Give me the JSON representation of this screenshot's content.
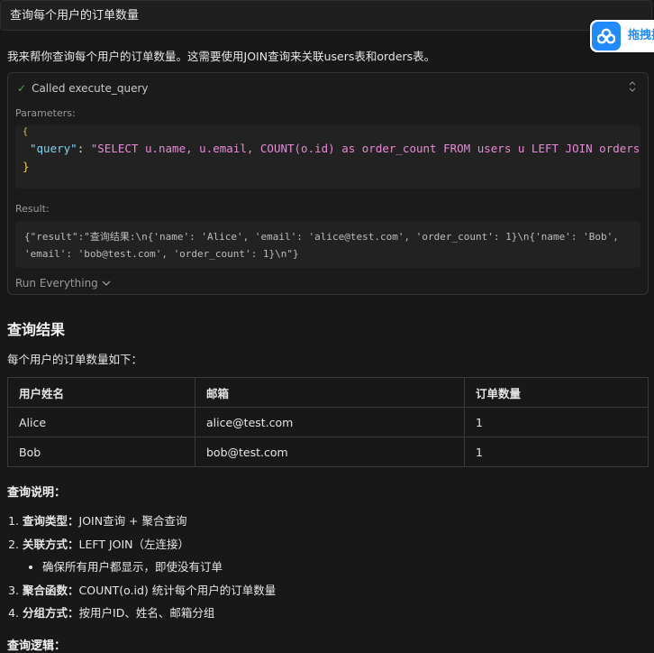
{
  "user_message": "查询每个用户的订单数量",
  "floating_button": {
    "label": "拖拽搜",
    "icon": "cloud-icon"
  },
  "intro": "我来帮你查询每个用户的订单数量。这需要使用JOIN查询来关联users表和orders表。",
  "tool_call": {
    "status": "Called execute_query",
    "status_icon": "check-icon",
    "parameters_label": "Parameters:",
    "param_key": "\"query\"",
    "param_value": "\"SELECT u.name, u.email, COUNT(o.id) as order_count FROM users u LEFT JOIN orders o ON u.id = o.user_id GROUP BY u.id, u.name, u.email\"",
    "result_label": "Result:",
    "result_text": "{\"result\":\"查询结果:\\n{'name': 'Alice', 'email': 'alice@test.com', 'order_count': 1}\\n{'name': 'Bob', 'email': 'bob@test.com', 'order_count': 1}\\n\"}",
    "run_label": "Run Everything"
  },
  "results_section": {
    "title": "查询结果",
    "subtitle": "每个用户的订单数量如下：",
    "columns": [
      "用户姓名",
      "邮箱",
      "订单数量"
    ],
    "rows": [
      [
        "Alice",
        "alice@test.com",
        "1"
      ],
      [
        "Bob",
        "bob@test.com",
        "1"
      ]
    ]
  },
  "explanation": {
    "title": "查询说明：",
    "items": [
      {
        "label": "查询类型：",
        "text": "JOIN查询 + 聚合查询"
      },
      {
        "label": "关联方式：",
        "text": "LEFT JOIN（左连接）",
        "sub": "确保所有用户都显示，即使没有订单"
      },
      {
        "label": "聚合函数：",
        "text": "COUNT(o.id) 统计每个用户的订单数量"
      },
      {
        "label": "分组方式：",
        "text": "按用户ID、姓名、邮箱分组"
      }
    ]
  },
  "logic_title": "查询逻辑："
}
